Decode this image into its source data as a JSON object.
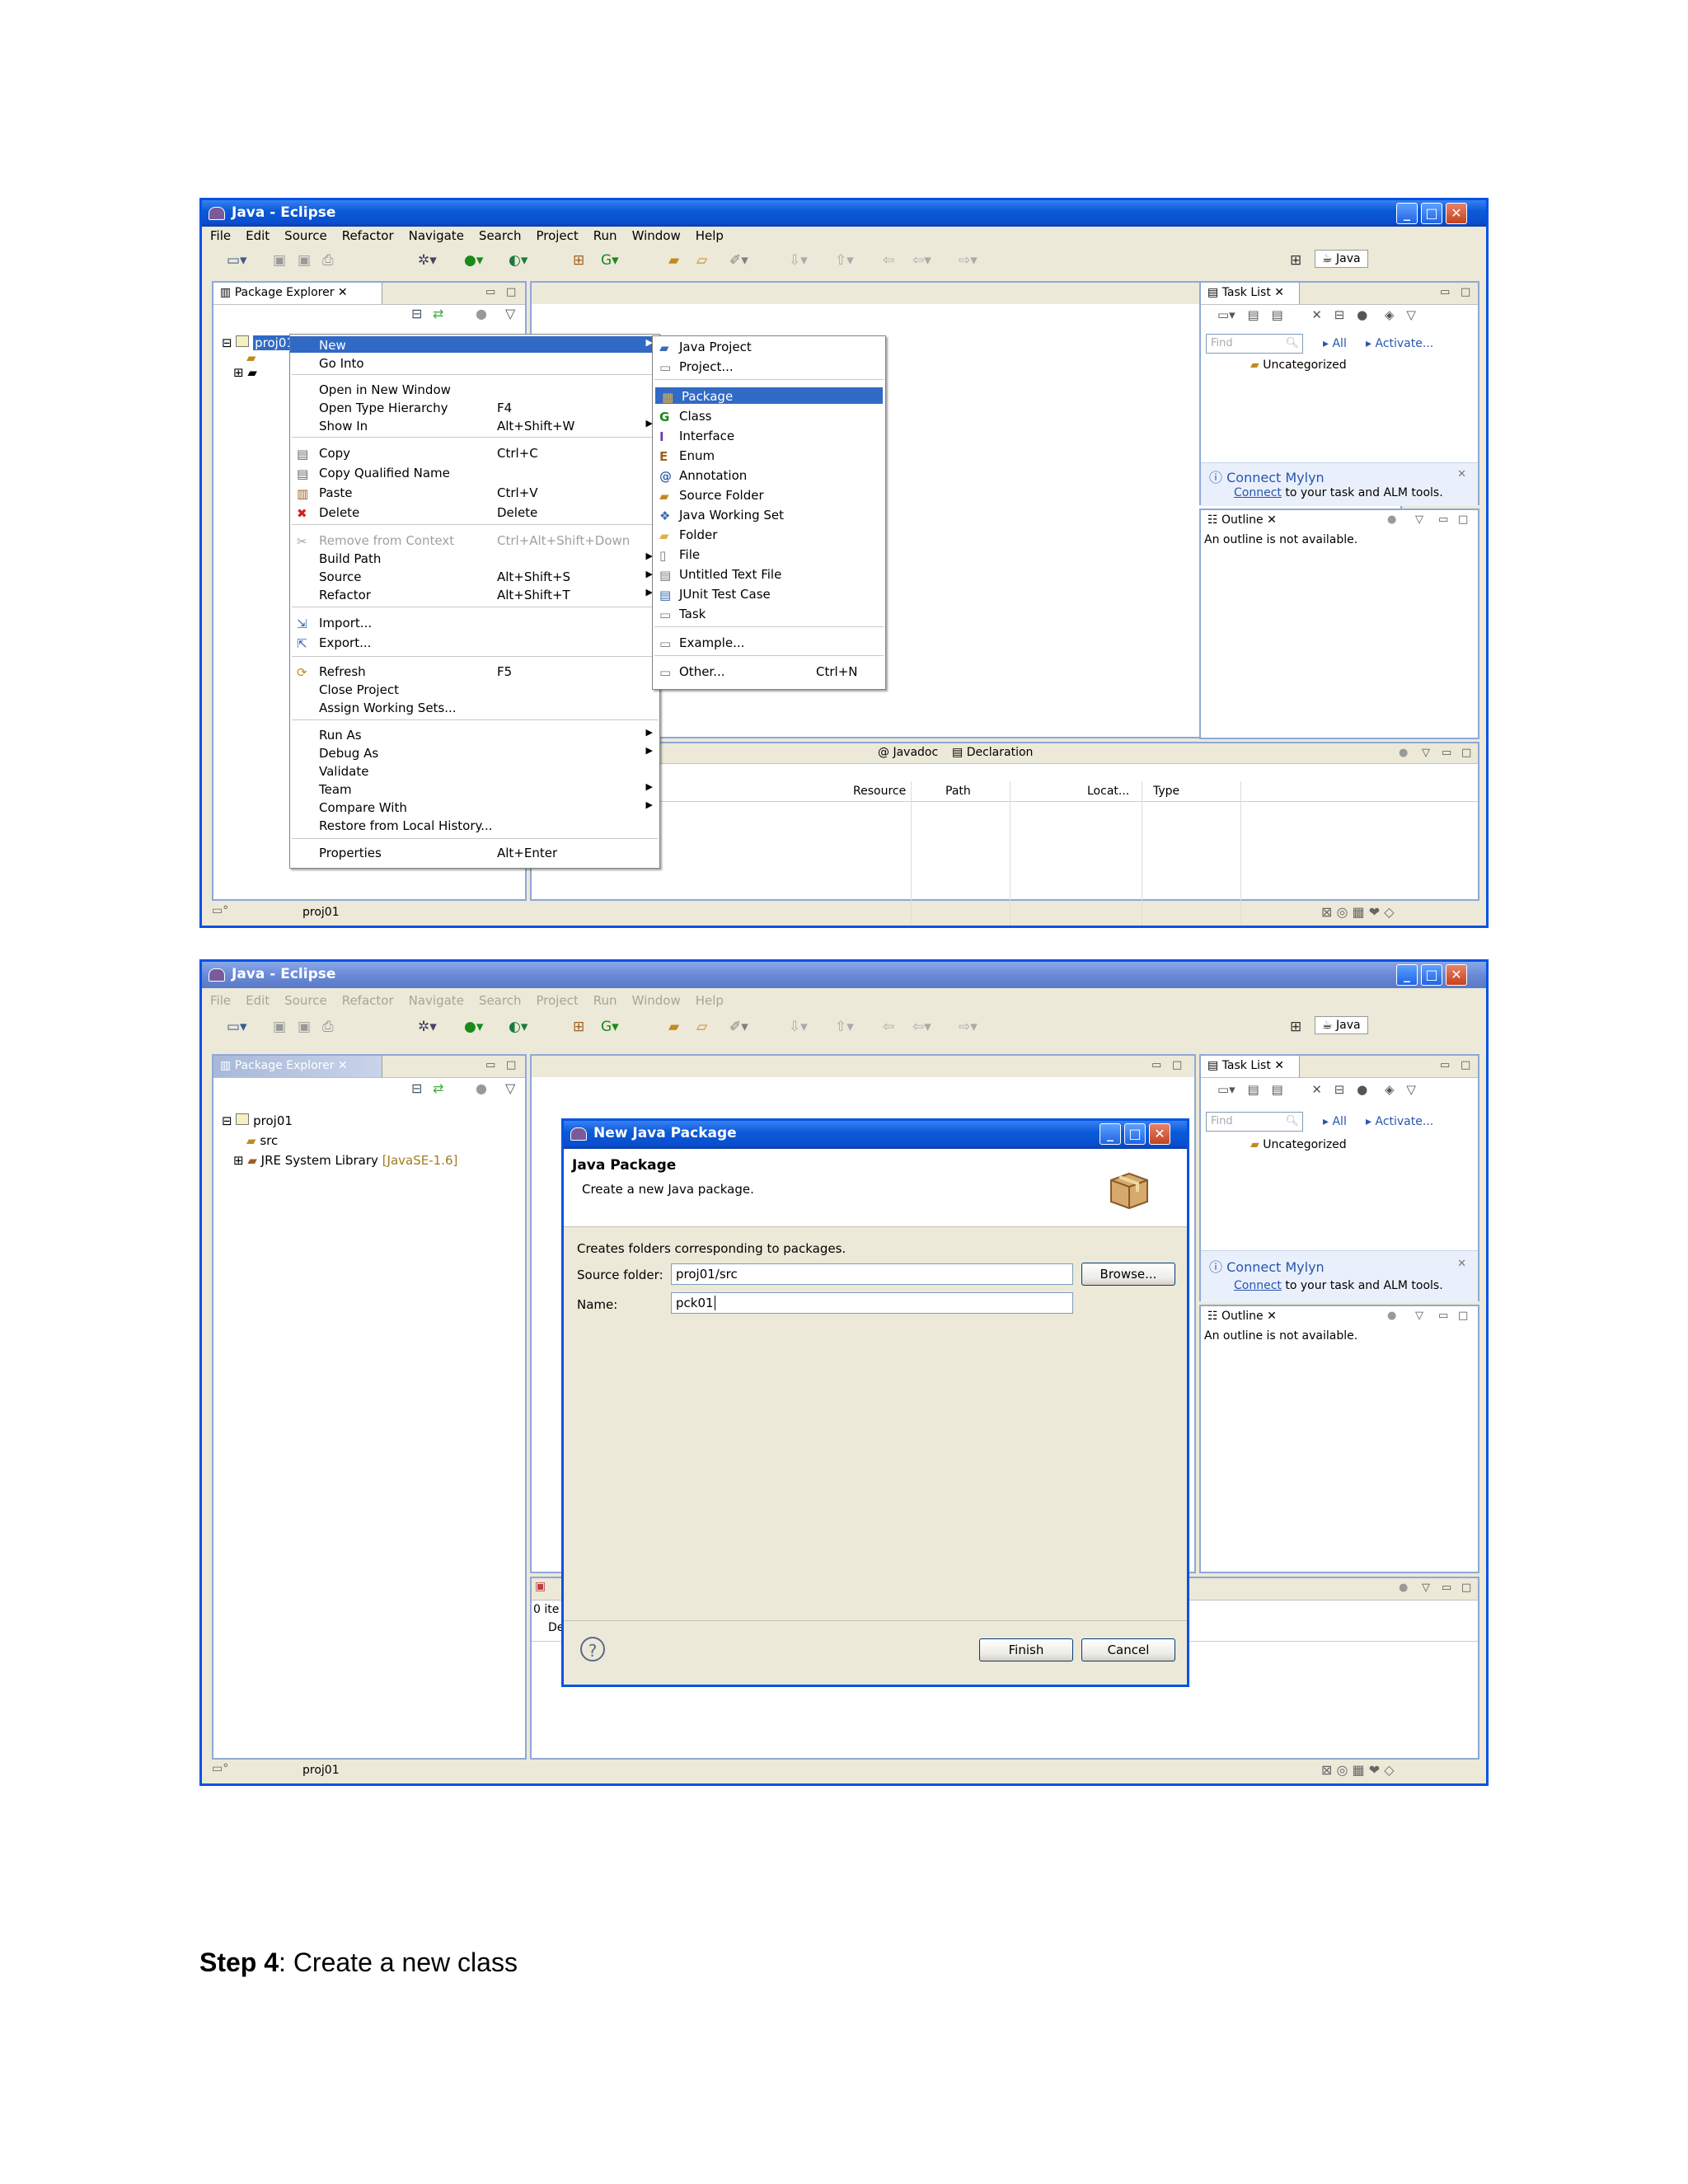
{
  "shot1": {
    "window_title": "Java - Eclipse",
    "menu": [
      "File",
      "Edit",
      "Source",
      "Refactor",
      "Navigate",
      "Search",
      "Project",
      "Run",
      "Window",
      "Help"
    ],
    "perspective": "Java",
    "package_explorer": {
      "tab": "Package Explorer",
      "project": "proj01"
    },
    "context_menu": [
      {
        "label": "New",
        "accel": "",
        "submenu": true,
        "selected": true
      },
      {
        "label": "Go Into",
        "accel": ""
      },
      {
        "label": "Open in New Window",
        "accel": ""
      },
      {
        "label": "Open Type Hierarchy",
        "accel": "F4"
      },
      {
        "label": "Show In",
        "accel": "Alt+Shift+W",
        "submenu": true
      },
      {
        "label": "Copy",
        "accel": "Ctrl+C"
      },
      {
        "label": "Copy Qualified Name",
        "accel": ""
      },
      {
        "label": "Paste",
        "accel": "Ctrl+V"
      },
      {
        "label": "Delete",
        "accel": "Delete"
      },
      {
        "label": "Remove from Context",
        "accel": "Ctrl+Alt+Shift+Down",
        "disabled": true
      },
      {
        "label": "Build Path",
        "accel": "",
        "submenu": true
      },
      {
        "label": "Source",
        "accel": "Alt+Shift+S",
        "submenu": true
      },
      {
        "label": "Refactor",
        "accel": "Alt+Shift+T",
        "submenu": true
      },
      {
        "label": "Import...",
        "accel": ""
      },
      {
        "label": "Export...",
        "accel": ""
      },
      {
        "label": "Refresh",
        "accel": "F5"
      },
      {
        "label": "Close Project",
        "accel": ""
      },
      {
        "label": "Assign Working Sets...",
        "accel": ""
      },
      {
        "label": "Run As",
        "accel": "",
        "submenu": true
      },
      {
        "label": "Debug As",
        "accel": "",
        "submenu": true
      },
      {
        "label": "Validate",
        "accel": ""
      },
      {
        "label": "Team",
        "accel": "",
        "submenu": true
      },
      {
        "label": "Compare With",
        "accel": "",
        "submenu": true
      },
      {
        "label": "Restore from Local History...",
        "accel": ""
      },
      {
        "label": "Properties",
        "accel": "Alt+Enter"
      }
    ],
    "new_submenu": [
      {
        "label": "Java Project",
        "accel": ""
      },
      {
        "label": "Project...",
        "accel": ""
      },
      {
        "label": "Package",
        "accel": "",
        "selected": true
      },
      {
        "label": "Class",
        "accel": ""
      },
      {
        "label": "Interface",
        "accel": ""
      },
      {
        "label": "Enum",
        "accel": ""
      },
      {
        "label": "Annotation",
        "accel": ""
      },
      {
        "label": "Source Folder",
        "accel": ""
      },
      {
        "label": "Java Working Set",
        "accel": ""
      },
      {
        "label": "Folder",
        "accel": ""
      },
      {
        "label": "File",
        "accel": ""
      },
      {
        "label": "Untitled Text File",
        "accel": ""
      },
      {
        "label": "JUnit Test Case",
        "accel": ""
      },
      {
        "label": "Task",
        "accel": ""
      },
      {
        "label": "Example...",
        "accel": ""
      },
      {
        "label": "Other...",
        "accel": "Ctrl+N"
      }
    ],
    "task_list": {
      "tab": "Task List",
      "find_placeholder": "Find",
      "all": "All",
      "activate": "Activate...",
      "uncategorized": "Uncategorized",
      "connect_title": "Connect Mylyn",
      "connect_link": "Connect",
      "connect_text": " to your task and ALM tools."
    },
    "outline": {
      "tab": "Outline",
      "message": "An outline is not available."
    },
    "bottom_tabs": [
      "Javadoc",
      "Declaration"
    ],
    "problems_columns": [
      "Resource",
      "Path",
      "Locat...",
      "Type"
    ],
    "status": "proj01"
  },
  "shot2": {
    "window_title": "Java - Eclipse",
    "menu": [
      "File",
      "Edit",
      "Source",
      "Refactor",
      "Navigate",
      "Search",
      "Project",
      "Run",
      "Window",
      "Help"
    ],
    "perspective": "Java",
    "package_explorer": {
      "tab": "Package Explorer",
      "project": "proj01",
      "src": "src",
      "jre": "JRE System Library",
      "jre_version": "[JavaSE-1.6]"
    },
    "task_list": {
      "tab": "Task List",
      "find_placeholder": "Find",
      "all": "All",
      "activate": "Activate...",
      "uncategorized": "Uncategorized",
      "connect_title": "Connect Mylyn",
      "connect_link": "Connect",
      "connect_text": " to your task and ALM tools."
    },
    "outline": {
      "tab": "Outline",
      "message": "An outline is not available."
    },
    "bottom_fragment": [
      "0 ite",
      "De"
    ],
    "dialog": {
      "title": "New Java Package",
      "heading": "Java Package",
      "subheading": "Create a new Java package.",
      "info": "Creates folders corresponding to packages.",
      "source_folder_label": "Source folder:",
      "source_folder_value": "proj01/src",
      "browse": "Browse...",
      "name_label": "Name:",
      "name_value": "pck01",
      "finish": "Finish",
      "cancel": "Cancel"
    },
    "status": "proj01"
  },
  "caption": {
    "bold": "Step 4",
    "text": ": Create a new class"
  }
}
